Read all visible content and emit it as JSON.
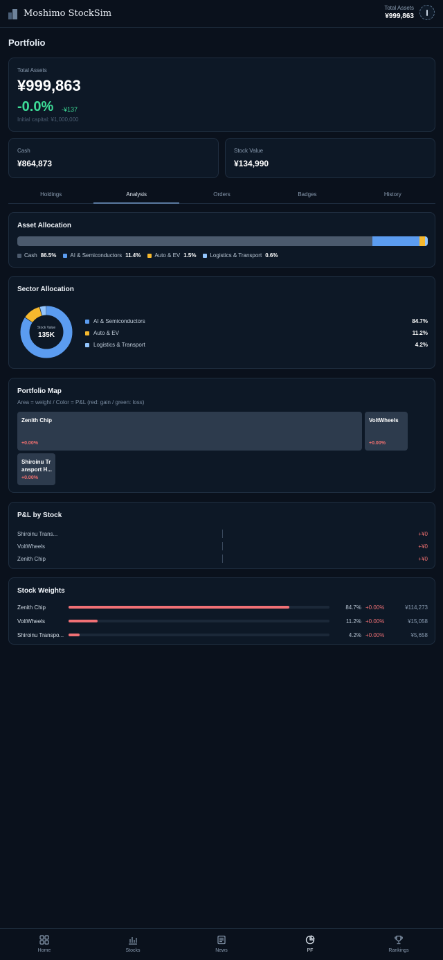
{
  "header": {
    "app_title": "Moshimo StockSim",
    "total_assets_label": "Total Assets",
    "total_assets_value": "¥999,863"
  },
  "page_title": "Portfolio",
  "summary": {
    "total_label": "Total Assets",
    "total_value": "¥999,863",
    "change_pct": "-0.0%",
    "change_abs": "-¥137",
    "initial": "Initial capital: ¥1,000,000",
    "cash_label": "Cash",
    "cash_value": "¥864,873",
    "stock_label": "Stock Value",
    "stock_value": "¥134,990"
  },
  "tabs": [
    {
      "label": "Holdings"
    },
    {
      "label": "Analysis"
    },
    {
      "label": "Orders"
    },
    {
      "label": "Badges"
    },
    {
      "label": "History"
    }
  ],
  "active_tab": "Analysis",
  "asset_allocation": {
    "title": "Asset Allocation",
    "items": [
      {
        "label": "Cash",
        "pct": "86.5%",
        "value": 86.5,
        "color": "#4b5a6d"
      },
      {
        "label": "AI & Semiconductors",
        "pct": "11.4%",
        "value": 11.4,
        "color": "#5b9cf0"
      },
      {
        "label": "Auto & EV",
        "pct": "1.5%",
        "value": 1.5,
        "color": "#f5b82e"
      },
      {
        "label": "Logistics & Transport",
        "pct": "0.6%",
        "value": 0.6,
        "color": "#93c5fd"
      }
    ]
  },
  "sector_allocation": {
    "title": "Sector Allocation",
    "center_label": "Stock Value",
    "center_value": "135K",
    "items": [
      {
        "label": "AI & Semiconductors",
        "pct": "84.7%",
        "value": 84.7,
        "color": "#5b9cf0"
      },
      {
        "label": "Auto & EV",
        "pct": "11.2%",
        "value": 11.2,
        "color": "#f5b82e"
      },
      {
        "label": "Logistics & Transport",
        "pct": "4.2%",
        "value": 4.2,
        "color": "#93c5fd"
      }
    ]
  },
  "portfolio_map": {
    "title": "Portfolio Map",
    "subtitle": "Area = weight / Color = P&L (red: gain / green: loss)",
    "tiles": [
      {
        "name": "Zenith Chip",
        "pct": "+0.00%"
      },
      {
        "name": "VoltWheels",
        "pct": "+0.00%"
      },
      {
        "name": "Shiroinu Tr ansport H...",
        "pct": "+0.00%"
      }
    ]
  },
  "pnl": {
    "title": "P&L by Stock",
    "rows": [
      {
        "name": "Shiroinu Trans...",
        "value": "+¥0"
      },
      {
        "name": "VoltWheels",
        "value": "+¥0"
      },
      {
        "name": "Zenith Chip",
        "value": "+¥0"
      }
    ]
  },
  "weights": {
    "title": "Stock Weights",
    "rows": [
      {
        "name": "Zenith Chip",
        "pct": "84.7%",
        "weight": 84.7,
        "change": "+0.00%",
        "value": "¥114,273"
      },
      {
        "name": "VoltWheels",
        "pct": "11.2%",
        "weight": 11.2,
        "change": "+0.00%",
        "value": "¥15,058"
      },
      {
        "name": "Shiroinu Transpo...",
        "pct": "4.2%",
        "weight": 4.2,
        "change": "+0.00%",
        "value": "¥5,658"
      }
    ]
  },
  "nav": [
    {
      "label": "Home",
      "icon": "home-grid-icon"
    },
    {
      "label": "Stocks",
      "icon": "stocks-chart-icon"
    },
    {
      "label": "News",
      "icon": "newspaper-icon"
    },
    {
      "label": "PF",
      "icon": "pie-chart-icon"
    },
    {
      "label": "Rankings",
      "icon": "trophy-icon"
    }
  ],
  "active_nav": "PF"
}
